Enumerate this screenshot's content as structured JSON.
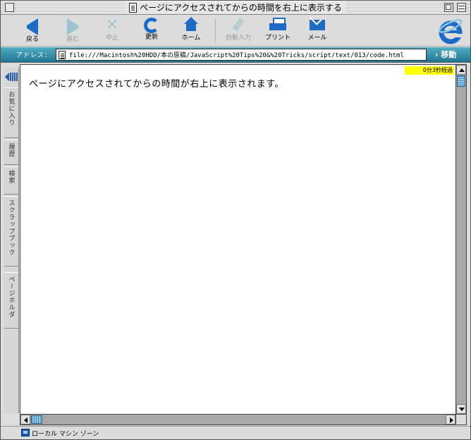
{
  "window": {
    "title": "ページにアクセスされてからの時間を右上に表示する"
  },
  "toolbar": {
    "back": "戻る",
    "forward": "進む",
    "stop": "中止",
    "refresh": "更新",
    "home": "ホーム",
    "autofill": "自動入力",
    "print": "プリント",
    "mail": "メール"
  },
  "address": {
    "label": "アドレス：",
    "url": "file:///Macintosh%20HDD/本の原稿/JavaScript%20Tips%20&%20Tricks/script/text/013/code.html",
    "go": "› 移動"
  },
  "sidebar": {
    "tabs": [
      "お気に入り",
      "履歴",
      "検索",
      "スクラップブック",
      "ページホルダ"
    ]
  },
  "content": {
    "timer": "0分3秒経過",
    "text": "ページにアクセスされてからの時間が右上に表示されます。"
  },
  "status": {
    "zone": "ローカル マシン ゾーン"
  },
  "colors": {
    "accent": "#1e6bc6",
    "address_bar": "#2f8fa6",
    "timer_bg": "#ffff00"
  }
}
